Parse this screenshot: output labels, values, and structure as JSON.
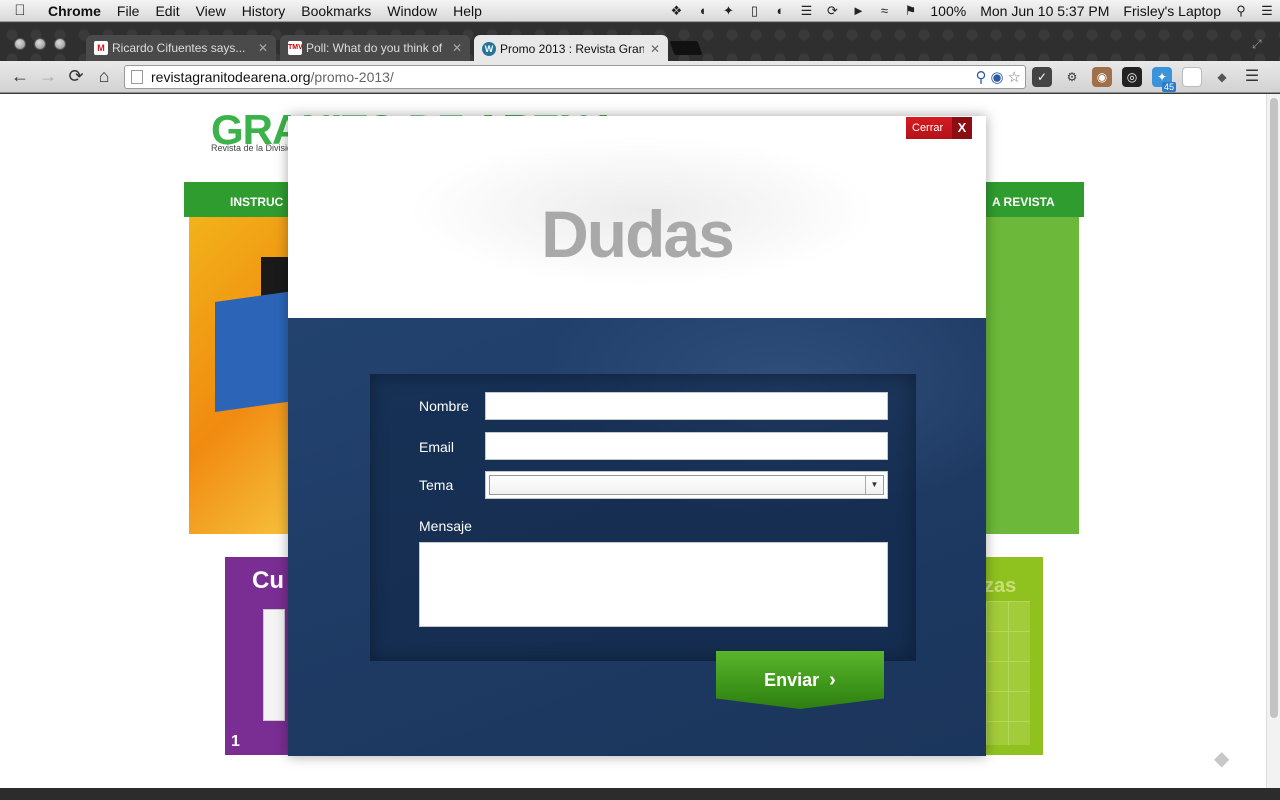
{
  "menubar": {
    "app": "Chrome",
    "items": [
      "File",
      "Edit",
      "View",
      "History",
      "Bookmarks",
      "Window",
      "Help"
    ],
    "battery": "100%",
    "clock": "Mon Jun 10  5:37 PM",
    "user": "Frisley's Laptop"
  },
  "tabs": [
    {
      "title": "Ricardo Cifuentes says...",
      "favicon": "gmail-icon",
      "active": false
    },
    {
      "title": "Poll: What do you think of",
      "favicon": "tmv-icon",
      "active": false
    },
    {
      "title": "Promo 2013 : Revista Gran",
      "favicon": "wordpress-icon",
      "active": true
    }
  ],
  "toolbar": {
    "url_host": "revistagranitodearena.org",
    "url_path": "/promo-2013/",
    "ext_badge": "45"
  },
  "site": {
    "logo": "GRANITO DE ARENA",
    "tagline": "Revista de la División",
    "nav_left": "INSTRUC",
    "nav_right": "A REVISTA",
    "card_left_title": "Cu",
    "card_left_num": "1",
    "card_right_title": "zas"
  },
  "modal": {
    "title": "Dudas",
    "close_label": "Cerrar",
    "close_x": "X",
    "fields": {
      "name_label": "Nombre",
      "email_label": "Email",
      "topic_label": "Tema",
      "message_label": "Mensaje"
    },
    "submit_label": "Enviar"
  },
  "colors": {
    "accent_green": "#3e9619",
    "modal_blue": "#1f3c66",
    "close_red": "#c8161d"
  }
}
